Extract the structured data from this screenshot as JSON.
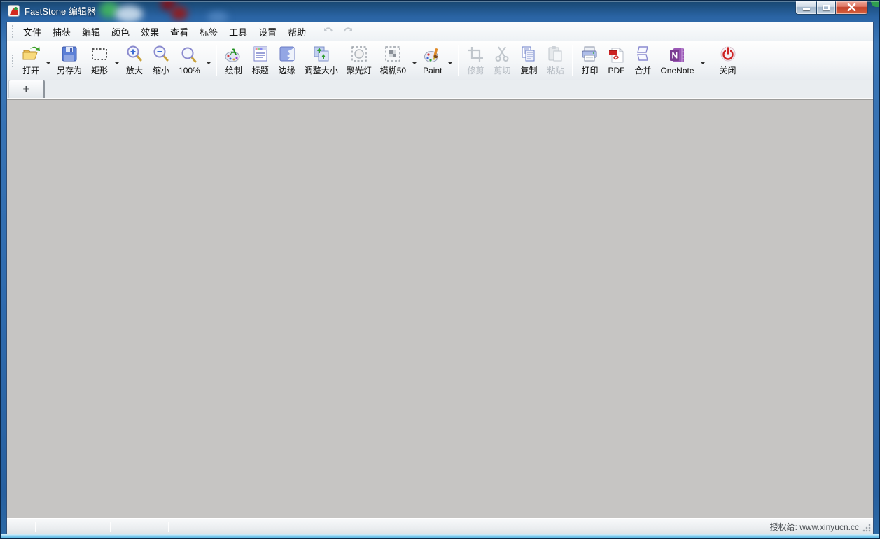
{
  "window": {
    "title": "FastStone 编辑器"
  },
  "menubar": {
    "items": [
      "文件",
      "捕获",
      "编辑",
      "颜色",
      "效果",
      "查看",
      "标签",
      "工具",
      "设置",
      "帮助"
    ]
  },
  "toolbar": {
    "items": [
      {
        "label": "打开",
        "icon": "open-icon",
        "dropdown": true,
        "disabled": false
      },
      {
        "label": "另存为",
        "icon": "save-icon",
        "dropdown": false,
        "disabled": false
      },
      {
        "label": "矩形",
        "icon": "rectangle-icon",
        "dropdown": true,
        "disabled": false
      },
      {
        "label": "放大",
        "icon": "zoom-in-icon",
        "dropdown": false,
        "disabled": false
      },
      {
        "label": "缩小",
        "icon": "zoom-out-icon",
        "dropdown": false,
        "disabled": false
      },
      {
        "label": "100%",
        "icon": "zoom-100-icon",
        "dropdown": true,
        "disabled": false
      },
      {
        "label": "绘制",
        "icon": "draw-icon",
        "dropdown": false,
        "disabled": false
      },
      {
        "label": "标题",
        "icon": "caption-icon",
        "dropdown": false,
        "disabled": false
      },
      {
        "label": "边缘",
        "icon": "edge-icon",
        "dropdown": false,
        "disabled": false
      },
      {
        "label": "调整大小",
        "icon": "resize-icon",
        "dropdown": false,
        "disabled": false
      },
      {
        "label": "聚光灯",
        "icon": "spotlight-icon",
        "dropdown": false,
        "disabled": false
      },
      {
        "label": "模糊50",
        "icon": "blur-icon",
        "dropdown": true,
        "disabled": false
      },
      {
        "label": "Paint",
        "icon": "paint-icon",
        "dropdown": true,
        "disabled": false
      },
      {
        "label": "修剪",
        "icon": "crop-icon",
        "dropdown": false,
        "disabled": true
      },
      {
        "label": "剪切",
        "icon": "cut-icon",
        "dropdown": false,
        "disabled": true
      },
      {
        "label": "复制",
        "icon": "copy-icon",
        "dropdown": false,
        "disabled": false
      },
      {
        "label": "粘贴",
        "icon": "paste-icon",
        "dropdown": false,
        "disabled": true
      },
      {
        "label": "打印",
        "icon": "print-icon",
        "dropdown": false,
        "disabled": false
      },
      {
        "label": "PDF",
        "icon": "pdf-icon",
        "dropdown": false,
        "disabled": false
      },
      {
        "label": "合并",
        "icon": "merge-icon",
        "dropdown": false,
        "disabled": false
      },
      {
        "label": "OneNote",
        "icon": "onenote-icon",
        "dropdown": true,
        "disabled": false
      },
      {
        "label": "关闭",
        "icon": "power-icon",
        "dropdown": false,
        "disabled": false
      }
    ]
  },
  "tabbar": {
    "new_tab": "+"
  },
  "statusbar": {
    "license": "授权给: www.xinyucn.cc"
  },
  "colors": {
    "titlebar_blue": "#3a76b6",
    "canvas_gray": "#c6c5c3",
    "close_button_red": "#c3422c",
    "aero_bottom_cyan": "#8ed2f1",
    "onenote_purple": "#7b3d91",
    "power_red": "#cc2222"
  }
}
